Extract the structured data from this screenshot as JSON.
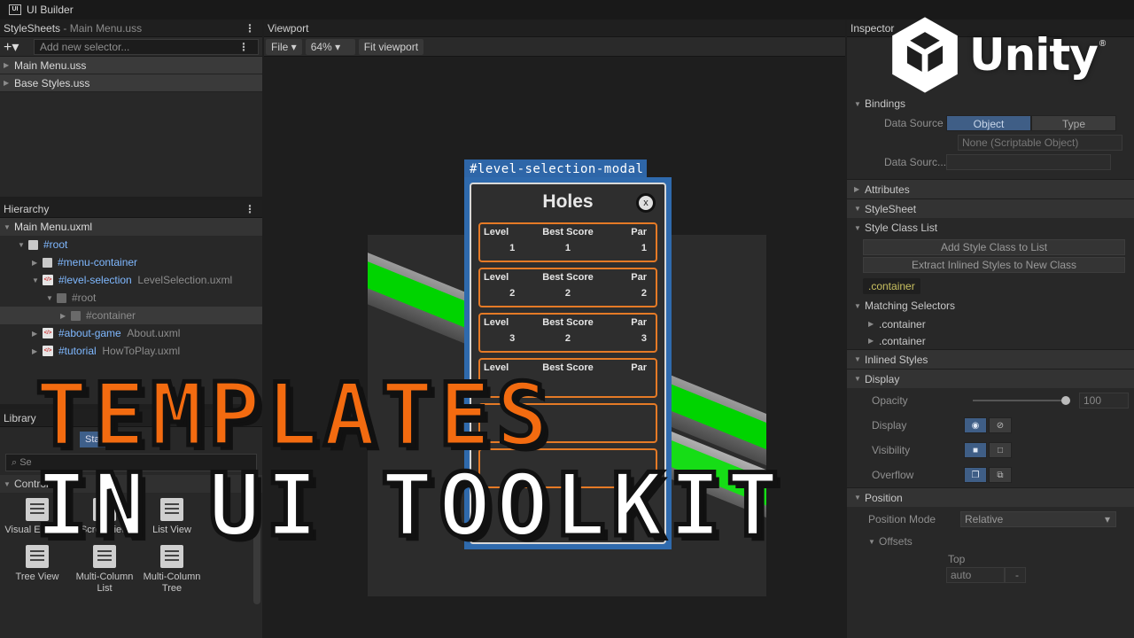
{
  "window": {
    "title": "UI Builder",
    "badge": "UI"
  },
  "stylesheets": {
    "header": "StyleSheets",
    "subheader": "- Main Menu.uss",
    "add_symbol": "+▾",
    "selector_placeholder": "Add new selector...",
    "items": [
      "Main Menu.uss",
      "Base Styles.uss"
    ]
  },
  "hierarchy": {
    "header": "Hierarchy",
    "document": "Main Menu.uxml",
    "rows": [
      {
        "name": "#root",
        "file": ""
      },
      {
        "name": "#menu-container",
        "file": ""
      },
      {
        "name": "#level-selection",
        "file": "LevelSelection.uxml"
      },
      {
        "name": "#root",
        "file": ""
      },
      {
        "name": "#container",
        "file": ""
      },
      {
        "name": "#about-game",
        "file": "About.uxml"
      },
      {
        "name": "#tutorial",
        "file": "HowToPlay.uxml"
      }
    ]
  },
  "library": {
    "header": "Library",
    "tab_standard": "Stand",
    "search": "Se",
    "section": "Controllers",
    "items": [
      "Visual Element",
      "Scroll View",
      "List View",
      "Tree View",
      "Multi-Column List",
      "Multi-Column Tree"
    ]
  },
  "viewport": {
    "header": "Viewport",
    "file_menu": "File ▾",
    "zoom": "64%",
    "fit_button": "Fit viewport",
    "modal_name": "#level-selection-modal",
    "modal_title": "Holes",
    "close_label": "x",
    "col_level": "Level",
    "col_score": "Best Score",
    "col_par": "Par",
    "cards": [
      {
        "level": "1",
        "score": "1",
        "par": "1"
      },
      {
        "level": "2",
        "score": "2",
        "par": "2"
      },
      {
        "level": "3",
        "score": "2",
        "par": "3"
      }
    ]
  },
  "overlay": {
    "line1": "TEMPLATES",
    "line2": "IN UI TOOLKIT",
    "logo": "Unity",
    "logo_mark": "®"
  },
  "inspector": {
    "header": "Inspector",
    "bindings": "Bindings",
    "data_source_label": "Data Source",
    "seg_object": "Object",
    "seg_type": "Type",
    "data_source_value": "None (Scriptable Object)",
    "data_source_path_label": "Data Sourc...",
    "attributes": "Attributes",
    "stylesheet": "StyleSheet",
    "style_class_list": "Style Class List",
    "add_class_btn": "Add Style Class to List",
    "extract_btn": "Extract Inlined Styles to New Class",
    "class_chip": ".container",
    "matching_selectors": "Matching Selectors",
    "selectors": [
      ".container",
      ".container"
    ],
    "inlined_styles": "Inlined Styles",
    "display_section": "Display",
    "opacity_label": "Opacity",
    "opacity_value": "100",
    "display_label": "Display",
    "visibility_label": "Visibility",
    "overflow_label": "Overflow",
    "position_section": "Position",
    "position_mode_label": "Position Mode",
    "position_mode_value": "Relative",
    "offsets_label": "Offsets",
    "top_label": "Top",
    "top_value": "auto"
  }
}
